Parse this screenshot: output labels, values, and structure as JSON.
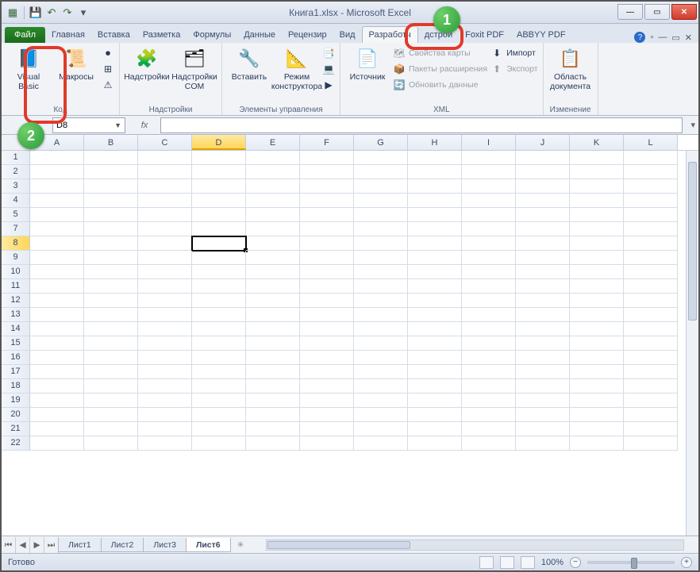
{
  "title": "Книга1.xlsx  -  Microsoft Excel",
  "tabs": {
    "file": "Файл",
    "items": [
      "Главная",
      "Вставка",
      "Разметка",
      "Формулы",
      "Данные",
      "Рецензир",
      "Вид",
      "Разработч",
      "дстрой",
      "Foxit PDF",
      "ABBYY PDF"
    ],
    "activeIndex": 7
  },
  "ribbon": {
    "code": {
      "vb": "Visual\nBasic",
      "macros": "Макросы",
      "label": "Код"
    },
    "addins": {
      "addins": "Надстройки",
      "com": "Надстройки\nCOM",
      "label": "Надстройки"
    },
    "controls": {
      "insert": "Вставить",
      "design": "Режим\nконструктора",
      "label": "Элементы управления"
    },
    "xml": {
      "source": "Источник",
      "mapprops": "Свойства карты",
      "expansion": "Пакеты расширения",
      "refresh": "Обновить данные",
      "import": "Импорт",
      "export": "Экспорт",
      "label": "XML"
    },
    "modify": {
      "docarea": "Область\nдокумента",
      "label": "Изменение"
    }
  },
  "namebox": "D8",
  "fx": "fx",
  "columns": [
    "A",
    "B",
    "C",
    "D",
    "E",
    "F",
    "G",
    "H",
    "I",
    "J",
    "K",
    "L"
  ],
  "selectedCol": "D",
  "rows": [
    1,
    2,
    3,
    4,
    5,
    7,
    8,
    9,
    10,
    11,
    12,
    13,
    14,
    15,
    16,
    17,
    18,
    19,
    20,
    21,
    22
  ],
  "selectedRow": 8,
  "sheets": {
    "items": [
      "Лист1",
      "Лист2",
      "Лист3",
      "Лист6"
    ],
    "activeIndex": 3
  },
  "status": "Готово",
  "zoom": "100%",
  "callouts": {
    "one": "1",
    "two": "2"
  }
}
